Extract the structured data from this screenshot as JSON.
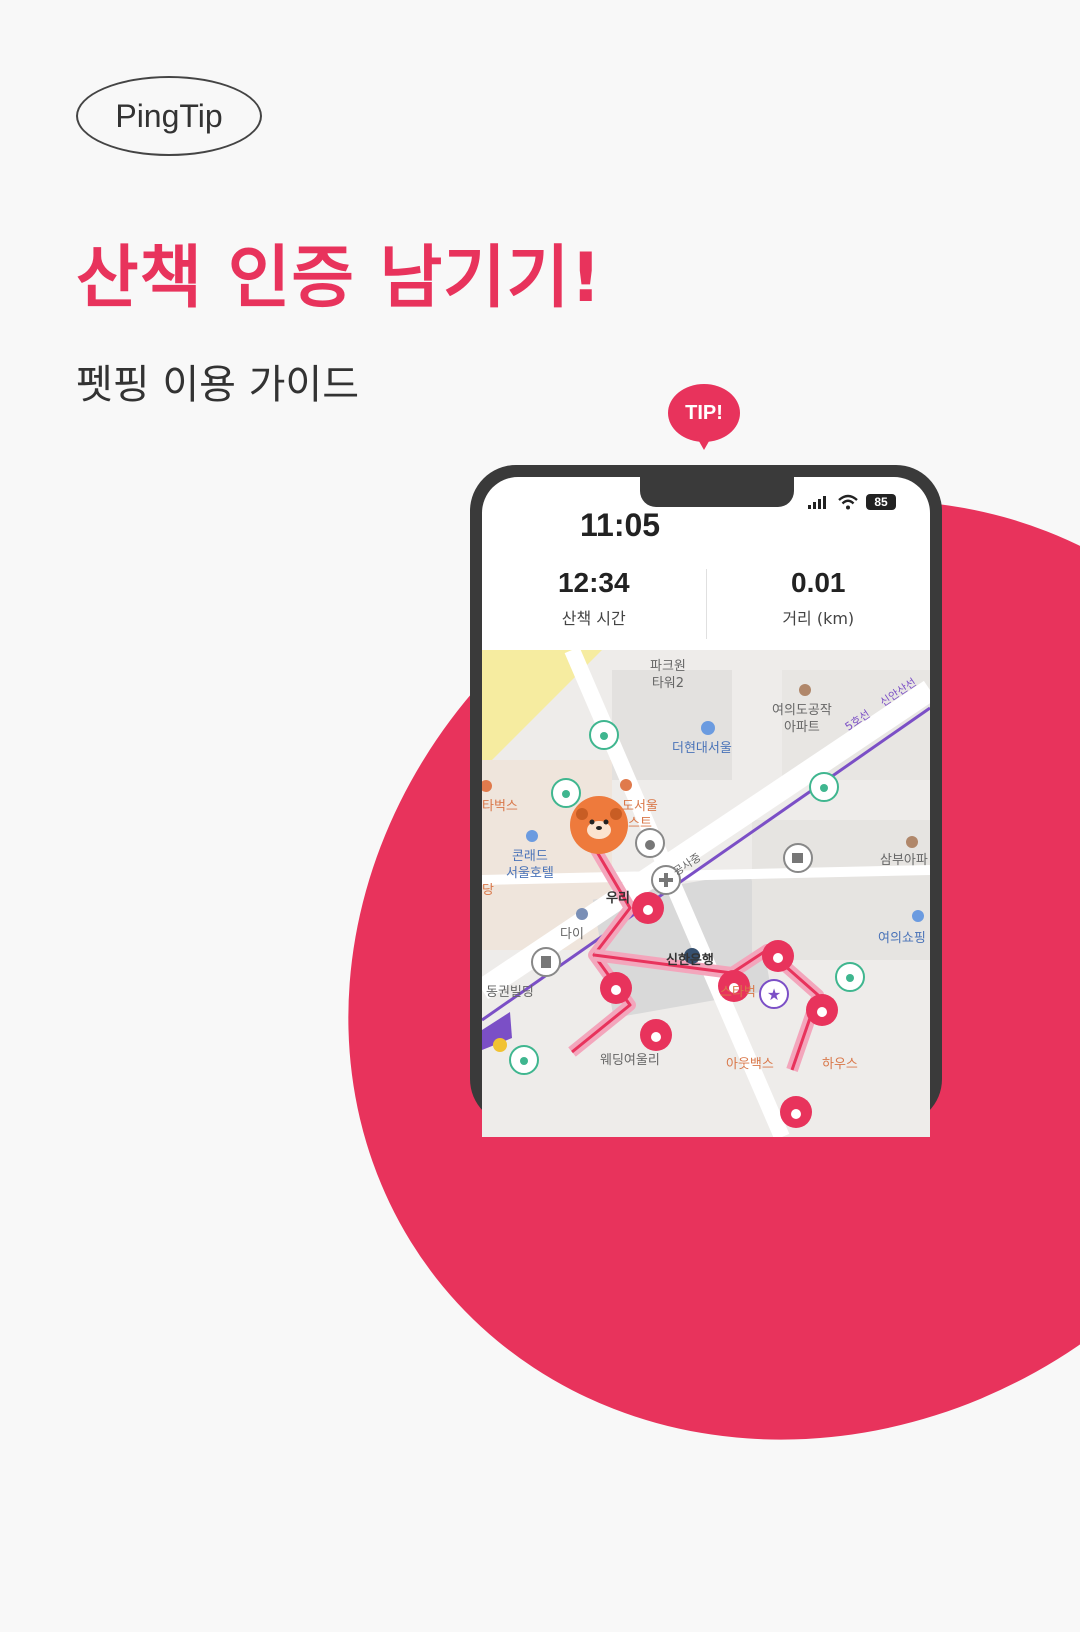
{
  "brand": {
    "label": "PingTip"
  },
  "headline": "산책 인증 남기기!",
  "subheadline": "펫핑 이용 가이드",
  "tip_badge": "TIP!",
  "phone": {
    "status_bar": {
      "time": "11:05",
      "battery": "85"
    },
    "walk_time": {
      "value": "12:34",
      "label": "산책 시간"
    },
    "distance": {
      "value": "0.01",
      "label": "거리 (km)"
    },
    "map": {
      "labels": {
        "park_one": "파크원\n타워2",
        "hyundai": "더현대서울",
        "yeouido_apt": "여의도공작\n아파트",
        "starbucks_left": "타벅스",
        "seoul_left": "도서울\n스트",
        "conrad": "콘래드\n서울호텔",
        "samboo": "삼부아파",
        "woori": "우리",
        "dang": "당",
        "dai": "다이",
        "shinhan": "신한은행",
        "yeoui_shopping": "여의쇼핑",
        "building": "동권빌딩",
        "starbucks_bottom": "스타벅",
        "wedding": "웨딩여울리",
        "outback": "아웃백스",
        "house": "하우스",
        "line5": "5호선",
        "sinan": "신안산선",
        "gongsa": "공사중"
      }
    }
  },
  "colors": {
    "accent": "#e8335c",
    "route": "#f3a6bc"
  }
}
